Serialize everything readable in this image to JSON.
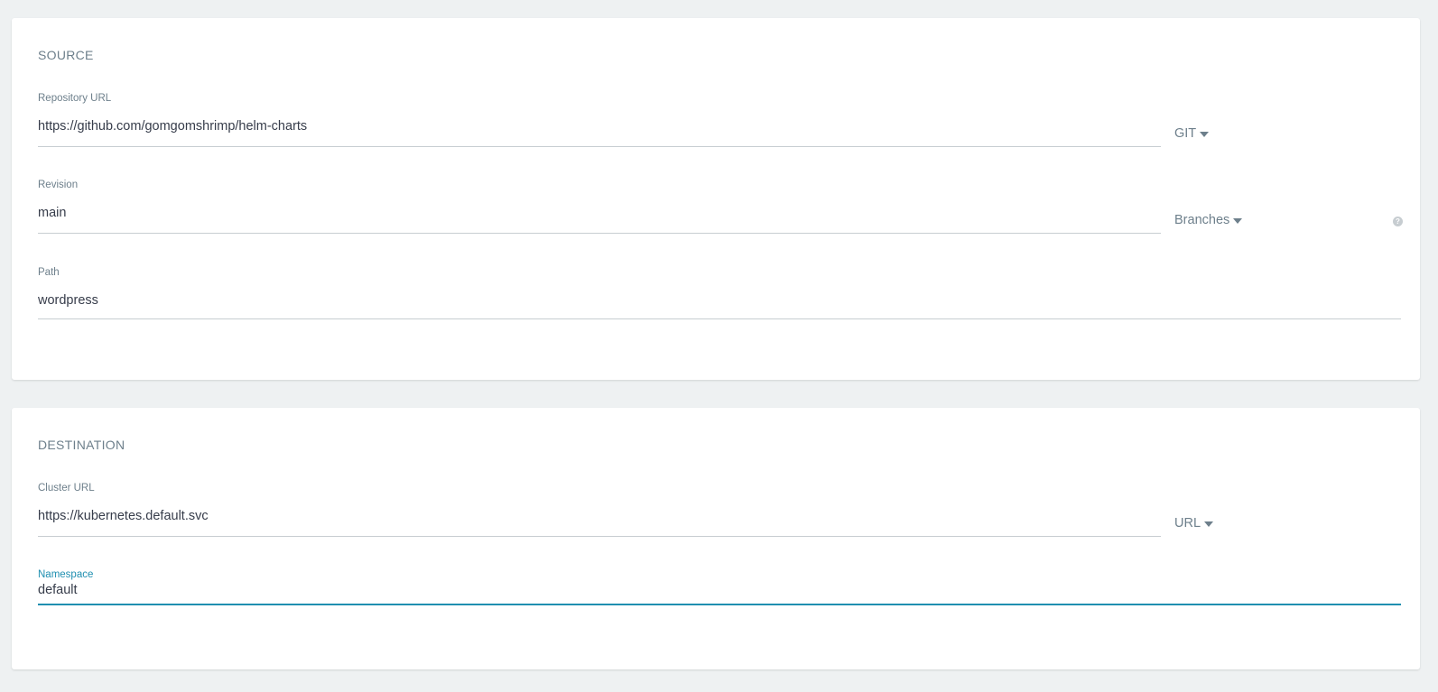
{
  "source": {
    "title": "SOURCE",
    "repo_url": {
      "label": "Repository URL",
      "value": "https://github.com/gomgomshrimp/helm-charts",
      "type": "GIT"
    },
    "revision": {
      "label": "Revision",
      "value": "main",
      "type": "Branches",
      "help_icon": "question-icon"
    },
    "path": {
      "label": "Path",
      "value": "wordpress"
    }
  },
  "destination": {
    "title": "DESTINATION",
    "cluster_url": {
      "label": "Cluster URL",
      "value": "https://kubernetes.default.svc",
      "type": "URL"
    },
    "namespace": {
      "label": "Namespace",
      "value": "default",
      "focused": true
    }
  },
  "colors": {
    "background": "#eef1f2",
    "card": "#ffffff",
    "muted_text": "#6d7f8b",
    "accent": "#1f8fb0",
    "underline": "#c7cdd1"
  }
}
